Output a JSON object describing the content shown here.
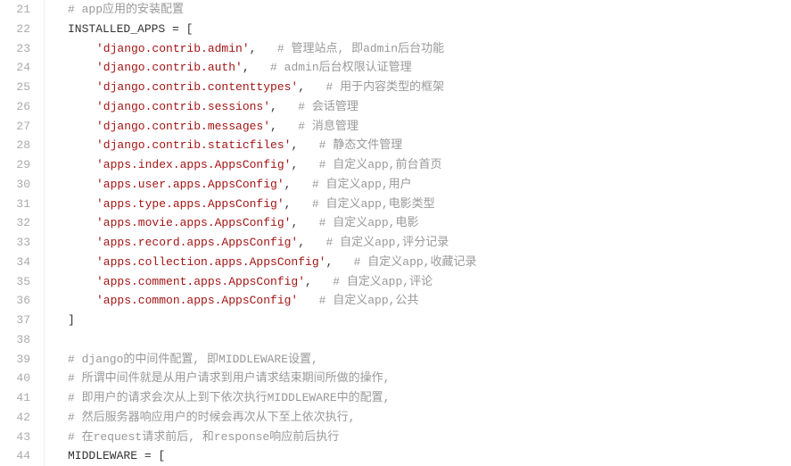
{
  "startLine": 21,
  "lines": [
    {
      "indent": 1,
      "parts": [
        {
          "t": "comment",
          "v": "# app应用的安装配置"
        }
      ]
    },
    {
      "indent": 1,
      "parts": [
        {
          "t": "ident",
          "v": "INSTALLED_APPS "
        },
        {
          "t": "punct",
          "v": "= ["
        }
      ]
    },
    {
      "indent": 2,
      "parts": [
        {
          "t": "string",
          "v": "'django.contrib.admin'"
        },
        {
          "t": "punct",
          "v": ",   "
        },
        {
          "t": "comment",
          "v": "# 管理站点, 即admin后台功能"
        }
      ]
    },
    {
      "indent": 2,
      "parts": [
        {
          "t": "string",
          "v": "'django.contrib.auth'"
        },
        {
          "t": "punct",
          "v": ",   "
        },
        {
          "t": "comment",
          "v": "# admin后台权限认证管理"
        }
      ]
    },
    {
      "indent": 2,
      "parts": [
        {
          "t": "string",
          "v": "'django.contrib.contenttypes'"
        },
        {
          "t": "punct",
          "v": ",   "
        },
        {
          "t": "comment",
          "v": "# 用于内容类型的框架"
        }
      ]
    },
    {
      "indent": 2,
      "parts": [
        {
          "t": "string",
          "v": "'django.contrib.sessions'"
        },
        {
          "t": "punct",
          "v": ",   "
        },
        {
          "t": "comment",
          "v": "# 会话管理"
        }
      ]
    },
    {
      "indent": 2,
      "parts": [
        {
          "t": "string",
          "v": "'django.contrib.messages'"
        },
        {
          "t": "punct",
          "v": ",   "
        },
        {
          "t": "comment",
          "v": "# 消息管理"
        }
      ]
    },
    {
      "indent": 2,
      "parts": [
        {
          "t": "string",
          "v": "'django.contrib.staticfiles'"
        },
        {
          "t": "punct",
          "v": ",   "
        },
        {
          "t": "comment",
          "v": "# 静态文件管理"
        }
      ]
    },
    {
      "indent": 2,
      "parts": [
        {
          "t": "string",
          "v": "'apps.index.apps.AppsConfig'"
        },
        {
          "t": "punct",
          "v": ",   "
        },
        {
          "t": "comment",
          "v": "# 自定义app,前台首页"
        }
      ]
    },
    {
      "indent": 2,
      "parts": [
        {
          "t": "string",
          "v": "'apps.user.apps.AppsConfig'"
        },
        {
          "t": "punct",
          "v": ",   "
        },
        {
          "t": "comment",
          "v": "# 自定义app,用户"
        }
      ]
    },
    {
      "indent": 2,
      "parts": [
        {
          "t": "string",
          "v": "'apps.type.apps.AppsConfig'"
        },
        {
          "t": "punct",
          "v": ",   "
        },
        {
          "t": "comment",
          "v": "# 自定义app,电影类型"
        }
      ]
    },
    {
      "indent": 2,
      "parts": [
        {
          "t": "string",
          "v": "'apps.movie.apps.AppsConfig'"
        },
        {
          "t": "punct",
          "v": ",   "
        },
        {
          "t": "comment",
          "v": "# 自定义app,电影"
        }
      ]
    },
    {
      "indent": 2,
      "parts": [
        {
          "t": "string",
          "v": "'apps.record.apps.AppsConfig'"
        },
        {
          "t": "punct",
          "v": ",   "
        },
        {
          "t": "comment",
          "v": "# 自定义app,评分记录"
        }
      ]
    },
    {
      "indent": 2,
      "parts": [
        {
          "t": "string",
          "v": "'apps.collection.apps.AppsConfig'"
        },
        {
          "t": "punct",
          "v": ",   "
        },
        {
          "t": "comment",
          "v": "# 自定义app,收藏记录"
        }
      ]
    },
    {
      "indent": 2,
      "parts": [
        {
          "t": "string",
          "v": "'apps.comment.apps.AppsConfig'"
        },
        {
          "t": "punct",
          "v": ",   "
        },
        {
          "t": "comment",
          "v": "# 自定义app,评论"
        }
      ]
    },
    {
      "indent": 2,
      "parts": [
        {
          "t": "string",
          "v": "'apps.common.apps.AppsConfig'"
        },
        {
          "t": "punct",
          "v": "   "
        },
        {
          "t": "comment",
          "v": "# 自定义app,公共"
        }
      ]
    },
    {
      "indent": 1,
      "parts": [
        {
          "t": "punct",
          "v": "]"
        }
      ]
    },
    {
      "indent": 0,
      "parts": []
    },
    {
      "indent": 1,
      "parts": [
        {
          "t": "comment",
          "v": "# django的中间件配置, 即MIDDLEWARE设置,"
        }
      ]
    },
    {
      "indent": 1,
      "parts": [
        {
          "t": "comment",
          "v": "# 所谓中间件就是从用户请求到用户请求结束期间所做的操作,"
        }
      ]
    },
    {
      "indent": 1,
      "parts": [
        {
          "t": "comment",
          "v": "# 即用户的请求会次从上到下依次执行MIDDLEWARE中的配置,"
        }
      ]
    },
    {
      "indent": 1,
      "parts": [
        {
          "t": "comment",
          "v": "# 然后服务器响应用户的时候会再次从下至上依次执行,"
        }
      ]
    },
    {
      "indent": 1,
      "parts": [
        {
          "t": "comment",
          "v": "# 在request请求前后, 和response响应前后执行"
        }
      ]
    },
    {
      "indent": 1,
      "parts": [
        {
          "t": "ident",
          "v": "MIDDLEWARE "
        },
        {
          "t": "punct",
          "v": "= ["
        }
      ]
    }
  ]
}
